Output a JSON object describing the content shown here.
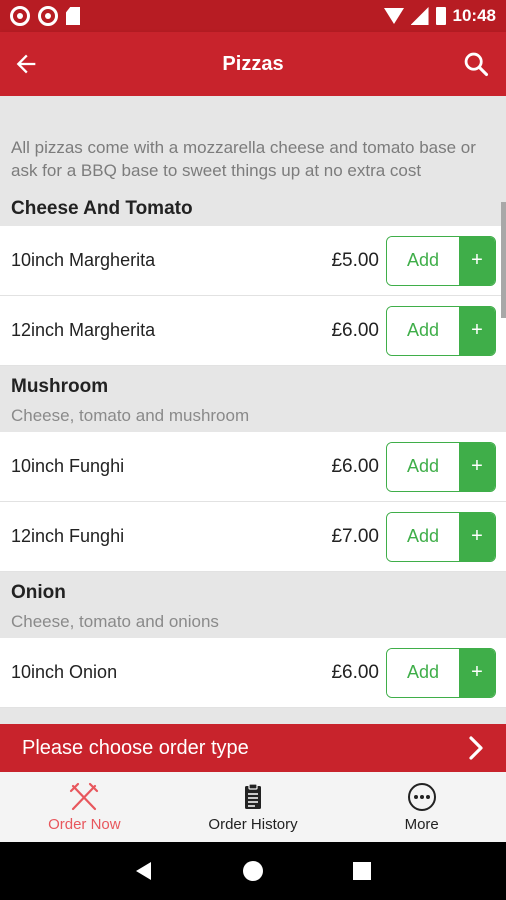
{
  "status_bar": {
    "time": "10:48"
  },
  "header": {
    "title": "Pizzas"
  },
  "intro_text": "All pizzas come with a mozzarella cheese and tomato base or ask for a BBQ base to sweet things up at no extra cost",
  "sections": [
    {
      "title": "Cheese And Tomato",
      "description": "",
      "items": [
        {
          "name": "10inch Margherita",
          "price": "£5.00",
          "add_label": "Add",
          "plus": "+"
        },
        {
          "name": "12inch Margherita",
          "price": "£6.00",
          "add_label": "Add",
          "plus": "+"
        }
      ]
    },
    {
      "title": "Mushroom",
      "description": "Cheese, tomato and mushroom",
      "items": [
        {
          "name": "10inch Funghi",
          "price": "£6.00",
          "add_label": "Add",
          "plus": "+"
        },
        {
          "name": "12inch Funghi",
          "price": "£7.00",
          "add_label": "Add",
          "plus": "+"
        }
      ]
    },
    {
      "title": "Onion",
      "description": "Cheese, tomato and onions",
      "items": [
        {
          "name": "10inch Onion",
          "price": "£6.00",
          "add_label": "Add",
          "plus": "+"
        }
      ]
    }
  ],
  "order_type_bar": {
    "label": "Please choose order type",
    "icon": "chevron-right-icon"
  },
  "bottom_nav": {
    "items": [
      {
        "label": "Order Now",
        "icon": "fork-knife-icon",
        "active": true
      },
      {
        "label": "Order History",
        "icon": "clipboard-icon",
        "active": false
      },
      {
        "label": "More",
        "icon": "more-icon",
        "active": false
      }
    ]
  },
  "colors": {
    "brand_red": "#c8232c",
    "status_red": "#b71c23",
    "add_green": "#3fae49",
    "active_nav": "#e8575d"
  }
}
